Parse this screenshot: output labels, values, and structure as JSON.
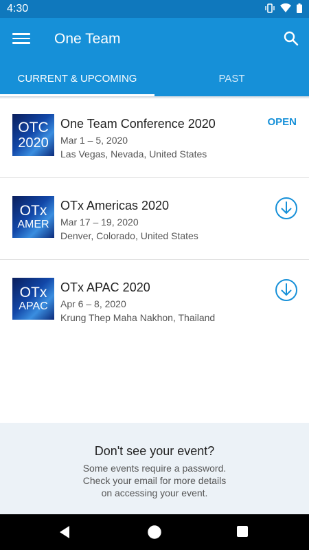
{
  "status_bar": {
    "time": "4:30"
  },
  "app_bar": {
    "title": "One Team"
  },
  "tabs": [
    {
      "label": "CURRENT & UPCOMING",
      "active": true
    },
    {
      "label": "PAST",
      "active": false
    }
  ],
  "events": [
    {
      "logo": [
        "OTC",
        "2020"
      ],
      "name": "One Team Conference 2020",
      "dates": "Mar 1 – 5, 2020",
      "location": "Las Vegas, Nevada, United States",
      "action": "OPEN"
    },
    {
      "logo": [
        "OTx",
        "AMER"
      ],
      "name": "OTx Americas 2020",
      "dates": "Mar 17 – 19, 2020",
      "location": "Denver, Colorado, United States",
      "action": "download-icon"
    },
    {
      "logo": [
        "OTx",
        "APAC"
      ],
      "name": "OTx APAC 2020",
      "dates": "Apr 6 – 8, 2020",
      "location": "Krung Thep Maha Nakhon, Thailand",
      "action": "download-icon"
    }
  ],
  "footer": {
    "title": "Don't see your event?",
    "lines": [
      "Some events require a password.",
      "Check your email for more details",
      "on accessing your event."
    ]
  },
  "colors": {
    "primary": "#1690d8",
    "status_bar": "#0f78bd",
    "footer_bg": "#ecf2f7"
  }
}
